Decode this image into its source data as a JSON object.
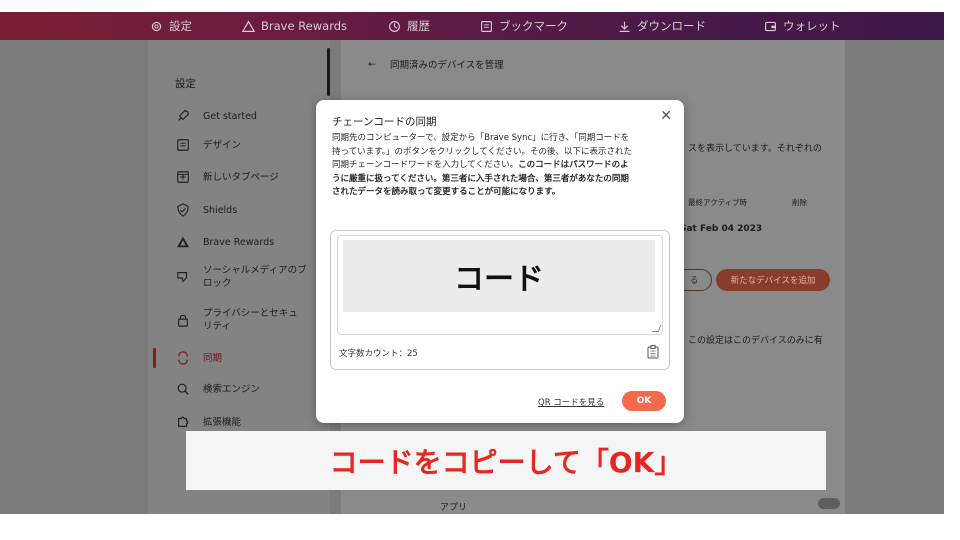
{
  "topbar": {
    "items": [
      {
        "label": "設定",
        "icon": "gear-icon"
      },
      {
        "label": "Brave Rewards",
        "icon": "triangle-icon"
      },
      {
        "label": "履歴",
        "icon": "history-icon"
      },
      {
        "label": "ブックマーク",
        "icon": "bookmark-icon"
      },
      {
        "label": "ダウンロード",
        "icon": "download-icon"
      },
      {
        "label": "ウォレット",
        "icon": "wallet-icon"
      }
    ]
  },
  "sidebar": {
    "title": "設定",
    "items": [
      {
        "label": "Get started",
        "icon": "rocket-icon"
      },
      {
        "label": "デザイン",
        "icon": "design-icon"
      },
      {
        "label": "新しいタブページ",
        "icon": "new-tab-icon"
      },
      {
        "label": "Shields",
        "icon": "shield-icon"
      },
      {
        "label": "Brave Rewards",
        "icon": "triangle-icon"
      },
      {
        "label": "ソーシャルメディアのブ\nロック",
        "icon": "thumbs-down-icon"
      },
      {
        "label": "プライバシーとセキュ\nリティ",
        "icon": "lock-icon"
      },
      {
        "label": "同期",
        "icon": "sync-icon"
      },
      {
        "label": "検索エンジン",
        "icon": "search-icon"
      },
      {
        "label": "拡張機能",
        "icon": "puzzle-icon"
      }
    ]
  },
  "content": {
    "back_label": "同期済みのデバイスを管理",
    "devices_text": "スを表示しています。それぞれの",
    "col_last_active": "最終アクティブ時",
    "col_delete": "削除",
    "last_active_value": "Sat Feb 04 2023",
    "btn_view_code": "る",
    "btn_add_device": "新たなデバイスを追加",
    "setting_note": "この設定はこのデバイスのみに有",
    "apps_label": "アプリ"
  },
  "dialog": {
    "title": "チェーンコードの同期",
    "desc_plain": "同期先のコンピューターで、設定から「Brave Sync」に行き、「同期コードを持っています。」のボタンをクリックしてください。その後、以下に表示された同期チェーンコードワードを入力してください。",
    "desc_bold": "このコードはパスワードのように厳重に扱ってください。第三者に入手された場合、第三者があなたの同期されたデータを読み取って変更することが可能になります。",
    "code_placeholder": "コード",
    "char_count": "文字数カウント：25",
    "qr_link": "QR コードを見る",
    "ok_label": "OK"
  },
  "caption": {
    "text": "コードをコピーして「OK」"
  },
  "colors": {
    "accent": "#f26a4b",
    "caption_red": "#e8251e",
    "active_red": "#8b1a1a"
  }
}
